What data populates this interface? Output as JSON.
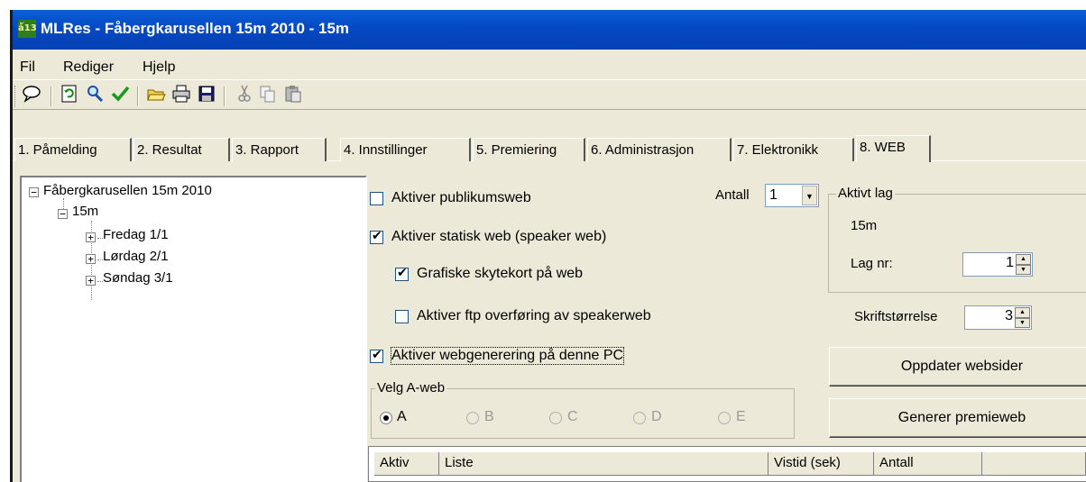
{
  "window": {
    "title": "MLRes - Fåbergkarusellen 15m 2010 - 15m",
    "app_icon_text": "ǻ13"
  },
  "menu": {
    "items": [
      "Fil",
      "Rediger",
      "Hjelp"
    ]
  },
  "toolbar": {
    "icons": [
      "speech-bubble-icon",
      "refresh-icon",
      "search-icon",
      "checkmark-icon",
      "open-folder-icon",
      "print-icon",
      "save-icon",
      "cut-icon",
      "copy-icon",
      "paste-icon"
    ]
  },
  "tabs": [
    {
      "label": "1. Påmelding"
    },
    {
      "label": "2. Resultat"
    },
    {
      "label": "3. Rapport"
    },
    {
      "label": "4. Innstillinger"
    },
    {
      "label": "5. Premiering"
    },
    {
      "label": "6. Administrasjon"
    },
    {
      "label": "7. Elektronikk"
    },
    {
      "label": "8. WEB",
      "active": true
    }
  ],
  "tree": {
    "root": "Fåbergkarusellen 15m 2010",
    "child": "15m",
    "days": [
      "Fredag 1/1",
      "Lørdag 2/1",
      "Søndag 3/1"
    ]
  },
  "options": {
    "publikumsweb": {
      "label": "Aktiver publikumsweb",
      "checked": false
    },
    "statisk_web": {
      "label": "Aktiver statisk web (speaker web)",
      "checked": true
    },
    "skytekort": {
      "label": "Grafiske skytekort på web",
      "checked": true
    },
    "ftp": {
      "label": "Aktiver ftp overføring av speakerweb",
      "checked": false
    },
    "webgenerering": {
      "label": "Aktiver webgenerering på denne PC",
      "checked": true
    }
  },
  "antall": {
    "label": "Antall",
    "value": "1"
  },
  "aktivt_lag": {
    "title": "Aktivt lag",
    "name": "15m",
    "lag_nr_label": "Lag nr:",
    "lag_nr_value": "1"
  },
  "skriftstorrelse": {
    "label": "Skriftstørrelse",
    "value": "3"
  },
  "buttons": {
    "oppdater": "Oppdater websider",
    "premieweb": "Generer premieweb"
  },
  "velg_aweb": {
    "title": "Velg A-web",
    "options": [
      "A",
      "B",
      "C",
      "D",
      "E"
    ],
    "selected": "A"
  },
  "grid": {
    "columns": [
      "Aktiv",
      "Liste",
      "Vistid (sek)",
      "Antall"
    ]
  }
}
